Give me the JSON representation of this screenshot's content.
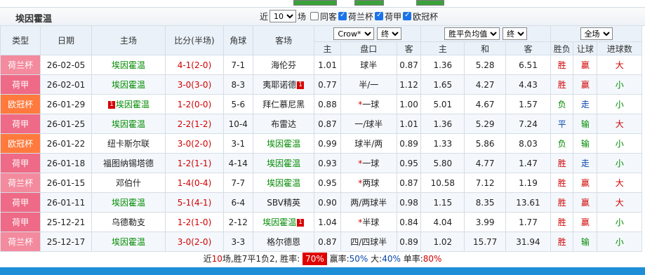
{
  "header": {
    "team_title": "埃因霍温",
    "filters": {
      "near_label": "近",
      "count_value": "10",
      "count_unit": "场",
      "same_home_label": "同客",
      "same_home_checked": false,
      "cups": [
        {
          "label": "荷兰杯",
          "checked": true
        },
        {
          "label": "荷甲",
          "checked": true
        },
        {
          "label": "欧冠杯",
          "checked": true
        }
      ]
    }
  },
  "columns": {
    "type": "类型",
    "date": "日期",
    "home": "主场",
    "score": "比分(半场)",
    "corner": "角球",
    "away": "客场",
    "company_select": "Crow*",
    "handicap_phase": "终",
    "euro_select": "胜平负均值",
    "euro_phase": "终",
    "scope_select": "全场",
    "sub_headers": [
      "主",
      "盘口",
      "客",
      "主",
      "和",
      "客",
      "胜负",
      "让球",
      "进球数"
    ]
  },
  "colors": {
    "cup_ho": "#f38a9d",
    "league": "#ee6a86",
    "ucl": "#ff7a3c",
    "win": "#d10000",
    "team_highlight": "#008a00",
    "bottom_bar": "#1e8fd7"
  },
  "matches": [
    {
      "type": "荷兰杯",
      "type_class": "t-ho",
      "date": "26-02-05",
      "home": "埃因霍温",
      "home_green": true,
      "home_badge": "",
      "score": "4-1(2-0)",
      "corner": "7-1",
      "away": "海伦芬",
      "away_green": false,
      "away_badge": "",
      "h_home": "1.01",
      "h_line": "球半",
      "h_line_star": false,
      "h_away": "0.87",
      "e_home": "1.36",
      "e_draw": "5.28",
      "e_away": "6.51",
      "result": "胜",
      "result_class": "red",
      "cover": "赢",
      "cover_class": "red",
      "ou": "大",
      "ou_class": "red"
    },
    {
      "type": "荷甲",
      "type_class": "t-jia",
      "date": "26-02-01",
      "home": "埃因霍温",
      "home_green": true,
      "home_badge": "",
      "score": "3-0(3-0)",
      "corner": "8-3",
      "away": "夷耶诺德",
      "away_green": false,
      "away_badge": "1",
      "h_home": "0.77",
      "h_line": "半/一",
      "h_line_star": false,
      "h_away": "1.12",
      "e_home": "1.65",
      "e_draw": "4.27",
      "e_away": "4.43",
      "result": "胜",
      "result_class": "red",
      "cover": "赢",
      "cover_class": "red",
      "ou": "小",
      "ou_class": "green"
    },
    {
      "type": "欧冠杯",
      "type_class": "t-ou",
      "date": "26-01-29",
      "home": "埃因霍温",
      "home_green": true,
      "home_badge": "1",
      "score": "1-2(0-0)",
      "corner": "5-6",
      "away": "拜仁慕尼黑",
      "away_green": false,
      "away_badge": "",
      "h_home": "0.88",
      "h_line": "一球",
      "h_line_star": true,
      "h_away": "1.00",
      "e_home": "5.01",
      "e_draw": "4.67",
      "e_away": "1.57",
      "result": "负",
      "result_class": "green",
      "cover": "走",
      "cover_class": "blue",
      "ou": "小",
      "ou_class": "green"
    },
    {
      "type": "荷甲",
      "type_class": "t-jia",
      "date": "26-01-25",
      "home": "埃因霍温",
      "home_green": true,
      "home_badge": "",
      "score": "2-2(1-2)",
      "corner": "10-4",
      "away": "布雷达",
      "away_green": false,
      "away_badge": "",
      "h_home": "0.87",
      "h_line": "一/球半",
      "h_line_star": false,
      "h_away": "1.01",
      "e_home": "1.36",
      "e_draw": "5.29",
      "e_away": "7.24",
      "result": "平",
      "result_class": "blue",
      "cover": "输",
      "cover_class": "green",
      "ou": "大",
      "ou_class": "red"
    },
    {
      "type": "欧冠杯",
      "type_class": "t-ou",
      "date": "26-01-22",
      "home": "纽卡斯尔联",
      "home_green": false,
      "home_badge": "",
      "score": "3-0(2-0)",
      "corner": "3-1",
      "away": "埃因霍温",
      "away_green": true,
      "away_badge": "",
      "h_home": "0.99",
      "h_line": "球半/两",
      "h_line_star": false,
      "h_away": "0.89",
      "e_home": "1.33",
      "e_draw": "5.86",
      "e_away": "8.03",
      "result": "负",
      "result_class": "green",
      "cover": "输",
      "cover_class": "green",
      "ou": "小",
      "ou_class": "green"
    },
    {
      "type": "荷甲",
      "type_class": "t-jia",
      "date": "26-01-18",
      "home": "福图纳锡塔德",
      "home_green": false,
      "home_badge": "",
      "score": "1-2(1-1)",
      "corner": "4-14",
      "away": "埃因霍温",
      "away_green": true,
      "away_badge": "",
      "h_home": "0.93",
      "h_line": "一球",
      "h_line_star": true,
      "h_away": "0.95",
      "e_home": "5.80",
      "e_draw": "4.77",
      "e_away": "1.47",
      "result": "胜",
      "result_class": "red",
      "cover": "走",
      "cover_class": "blue",
      "ou": "小",
      "ou_class": "green"
    },
    {
      "type": "荷兰杯",
      "type_class": "t-ho",
      "date": "26-01-15",
      "home": "邓伯什",
      "home_green": false,
      "home_badge": "",
      "score": "1-4(0-4)",
      "corner": "7-7",
      "away": "埃因霍温",
      "away_green": true,
      "away_badge": "",
      "h_home": "0.95",
      "h_line": "两球",
      "h_line_star": true,
      "h_away": "0.87",
      "e_home": "10.58",
      "e_draw": "7.12",
      "e_away": "1.19",
      "result": "胜",
      "result_class": "red",
      "cover": "赢",
      "cover_class": "red",
      "ou": "大",
      "ou_class": "red"
    },
    {
      "type": "荷甲",
      "type_class": "t-jia",
      "date": "26-01-11",
      "home": "埃因霍温",
      "home_green": true,
      "home_badge": "",
      "score": "5-1(4-1)",
      "corner": "6-4",
      "away": "SBV精英",
      "away_green": false,
      "away_badge": "",
      "h_home": "0.90",
      "h_line": "两/两球半",
      "h_line_star": false,
      "h_away": "0.98",
      "e_home": "1.15",
      "e_draw": "8.35",
      "e_away": "13.61",
      "result": "胜",
      "result_class": "red",
      "cover": "赢",
      "cover_class": "red",
      "ou": "大",
      "ou_class": "red"
    },
    {
      "type": "荷甲",
      "type_class": "t-jia",
      "date": "25-12-21",
      "home": "乌德勒支",
      "home_green": false,
      "home_badge": "",
      "score": "1-2(1-0)",
      "corner": "2-12",
      "away": "埃因霍温",
      "away_green": true,
      "away_badge": "1",
      "h_home": "1.04",
      "h_line": "半球",
      "h_line_star": true,
      "h_away": "0.84",
      "e_home": "4.04",
      "e_draw": "3.99",
      "e_away": "1.77",
      "result": "胜",
      "result_class": "red",
      "cover": "赢",
      "cover_class": "red",
      "ou": "小",
      "ou_class": "green"
    },
    {
      "type": "荷兰杯",
      "type_class": "t-ho",
      "date": "25-12-17",
      "home": "埃因霍温",
      "home_green": true,
      "home_badge": "",
      "score": "3-0(2-0)",
      "corner": "3-3",
      "away": "格尔德恩",
      "away_green": false,
      "away_badge": "",
      "h_home": "0.87",
      "h_line": "四/四球半",
      "h_line_star": false,
      "h_away": "0.89",
      "e_home": "1.02",
      "e_draw": "15.77",
      "e_away": "31.94",
      "result": "胜",
      "result_class": "red",
      "cover": "输",
      "cover_class": "green",
      "ou": "小",
      "ou_class": "green"
    }
  ],
  "summary": {
    "prefix": "近",
    "count": "10",
    "record": "场,胜7平1负2, 胜率:",
    "win_rate": "70%",
    "cover_label": "赢率:",
    "cover_rate": "50%",
    "big_label": "大:",
    "big_rate": "40%",
    "odd_label": "单率:",
    "odd_rate": "80%"
  }
}
